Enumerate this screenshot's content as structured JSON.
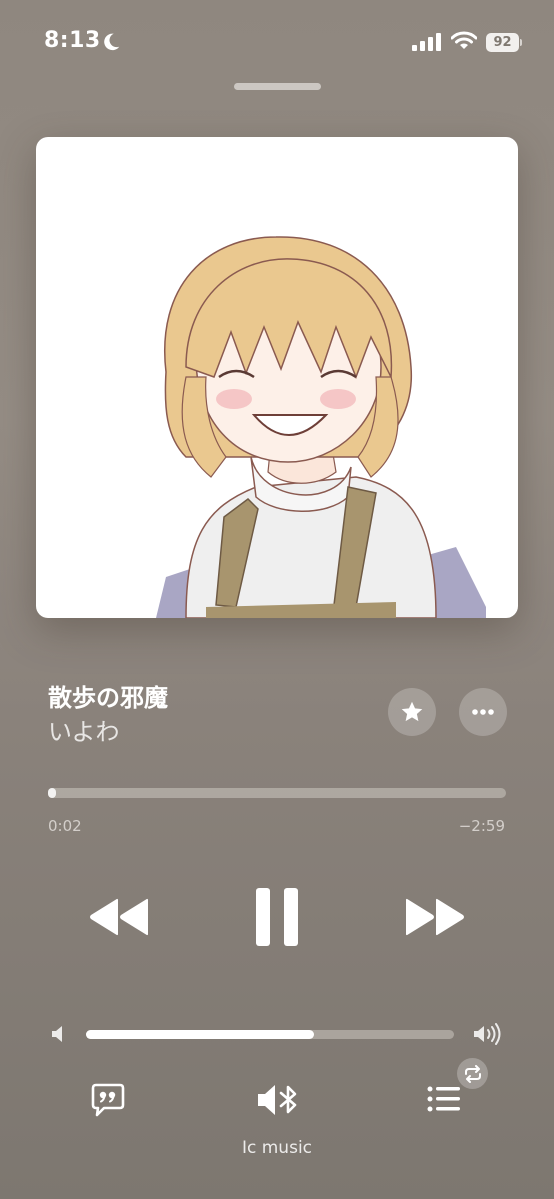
{
  "status_bar": {
    "time": "8:13",
    "battery": "92",
    "icons": [
      "moon-icon",
      "cellular-signal-icon",
      "wifi-icon",
      "battery-icon"
    ]
  },
  "track": {
    "title": "散歩の邪魔",
    "artist": "いよわ"
  },
  "progress": {
    "elapsed": "0:02",
    "remaining": "−2:59",
    "fraction": 0.01
  },
  "volume": {
    "fraction": 0.62
  },
  "controls": [
    "rewind-icon",
    "pause-icon",
    "fast-forward-icon"
  ],
  "bottom_bar": {
    "device_name": "Ic music",
    "icons": [
      "lyrics-icon",
      "bluetooth-speaker-icon",
      "queue-list-icon",
      "repeat-icon"
    ]
  },
  "colors": {
    "background": "#8f877f",
    "accent": "#ffffff"
  }
}
